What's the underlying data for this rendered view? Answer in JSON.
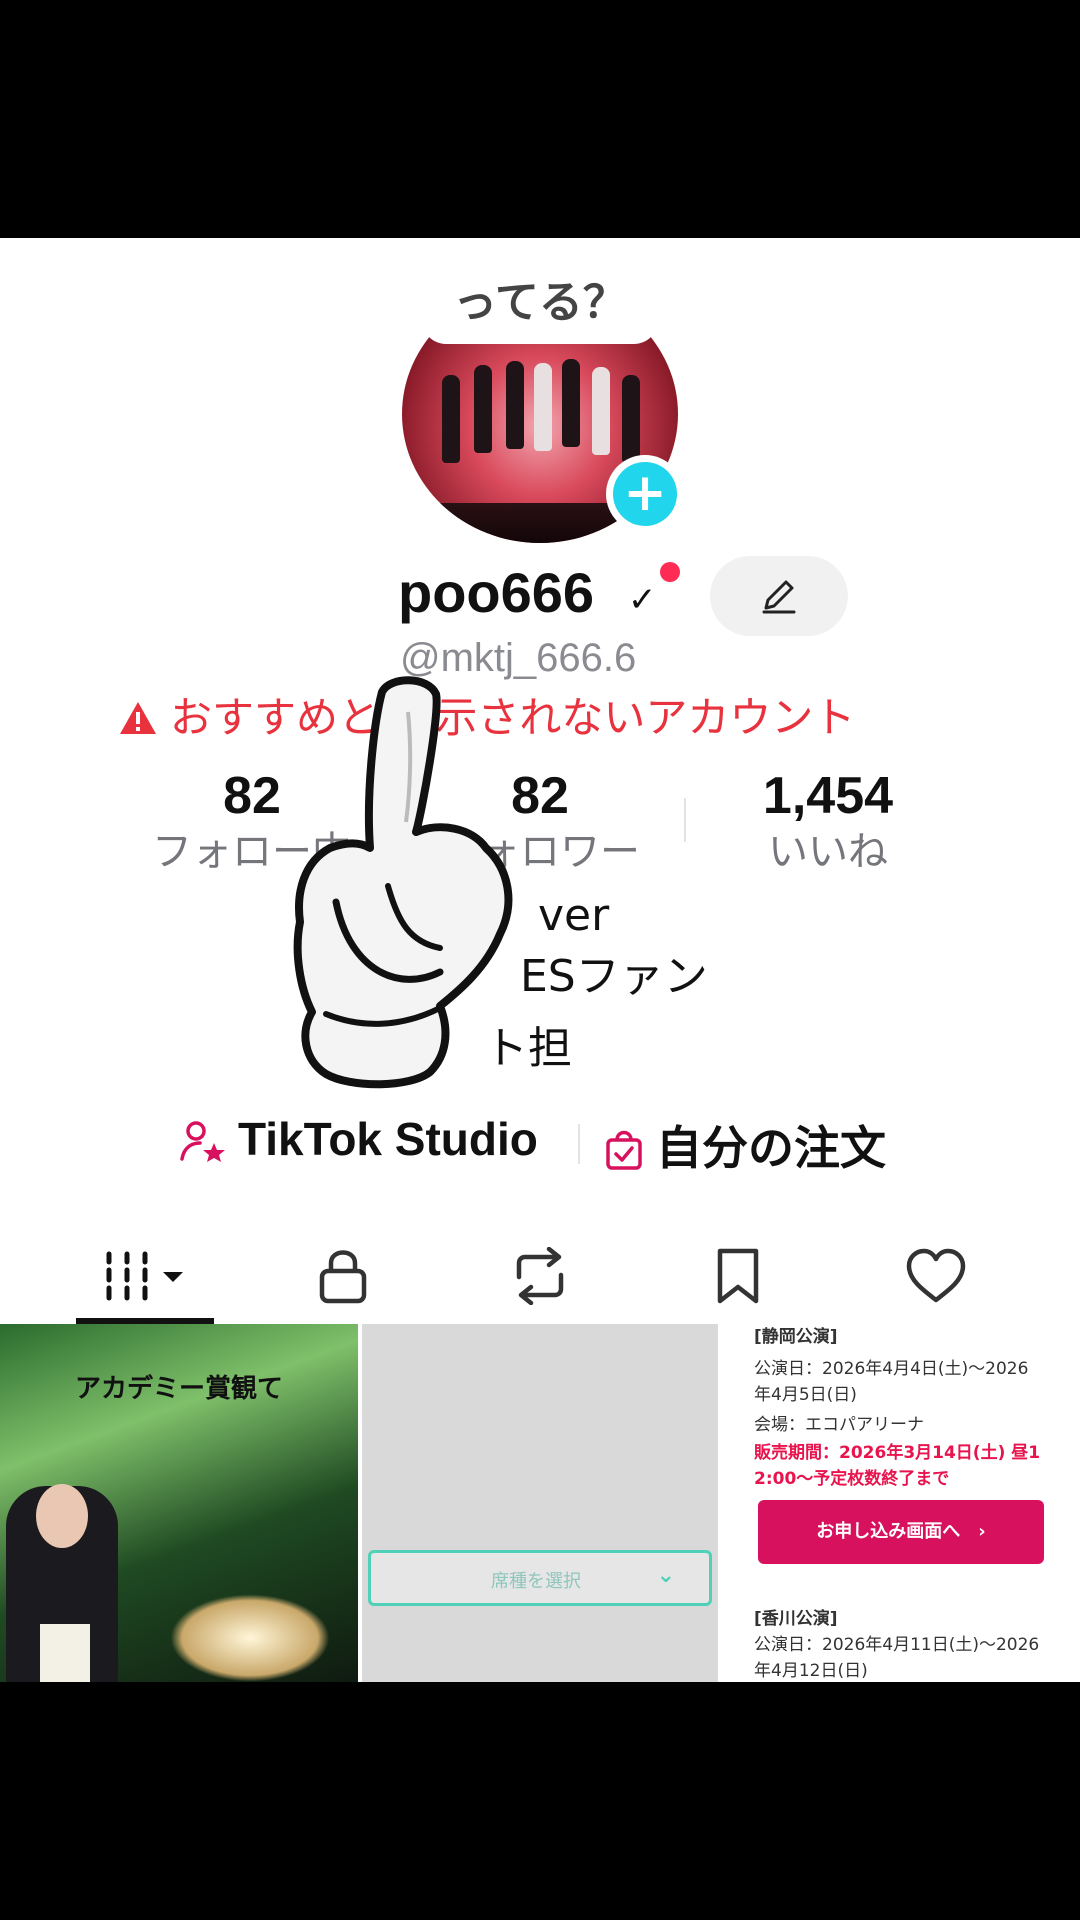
{
  "profile": {
    "avatar_caption": "ってる？",
    "username": "poo666",
    "handle": "@mktj_666.6",
    "warning": "おすすめと  表示されないアカウント"
  },
  "stats": [
    {
      "value": "82",
      "label": "フォロー中"
    },
    {
      "value": "82",
      "label": "フォロワー"
    },
    {
      "value": "1,454",
      "label": "いいね"
    }
  ],
  "bio": {
    "line1": "ver",
    "line2": "ESファン",
    "line3": "ト担"
  },
  "actions": {
    "studio": "TikTok Studio",
    "orders": "自分の注文"
  },
  "tabs": [
    {
      "icon": "grid-icon",
      "active": true
    },
    {
      "icon": "lock-icon",
      "active": false
    },
    {
      "icon": "repost-icon",
      "active": false
    },
    {
      "icon": "bookmark-icon",
      "active": false
    },
    {
      "icon": "heart-icon",
      "active": false
    }
  ],
  "videos": {
    "v1_caption": "アカデミー賞観て",
    "v2_select": "席種を選択",
    "v3": {
      "shizuoka_title": "[静岡公演]",
      "shizuoka_date1": "公演日：2026年4月4日(土)～2026",
      "shizuoka_date2": "年4月5日(日)",
      "shizuoka_venue": "会場：エコパアリーナ",
      "shizuoka_sale1": "販売期間：2026年3月14日(土) 昼1",
      "shizuoka_sale2": "2:00～予定枚数終了まで",
      "apply_button": "お申し込み画面へ　›",
      "kagawa_title": "[香川公演]",
      "kagawa_date1": "公演日：2026年4月11日(土)～2026",
      "kagawa_date2": "年4月12日(日)"
    }
  },
  "colors": {
    "accent_red": "#fe2c55",
    "warning_red": "#e8323e",
    "plus_cyan": "#20d5ec",
    "studio_icon": "#d8115e"
  }
}
